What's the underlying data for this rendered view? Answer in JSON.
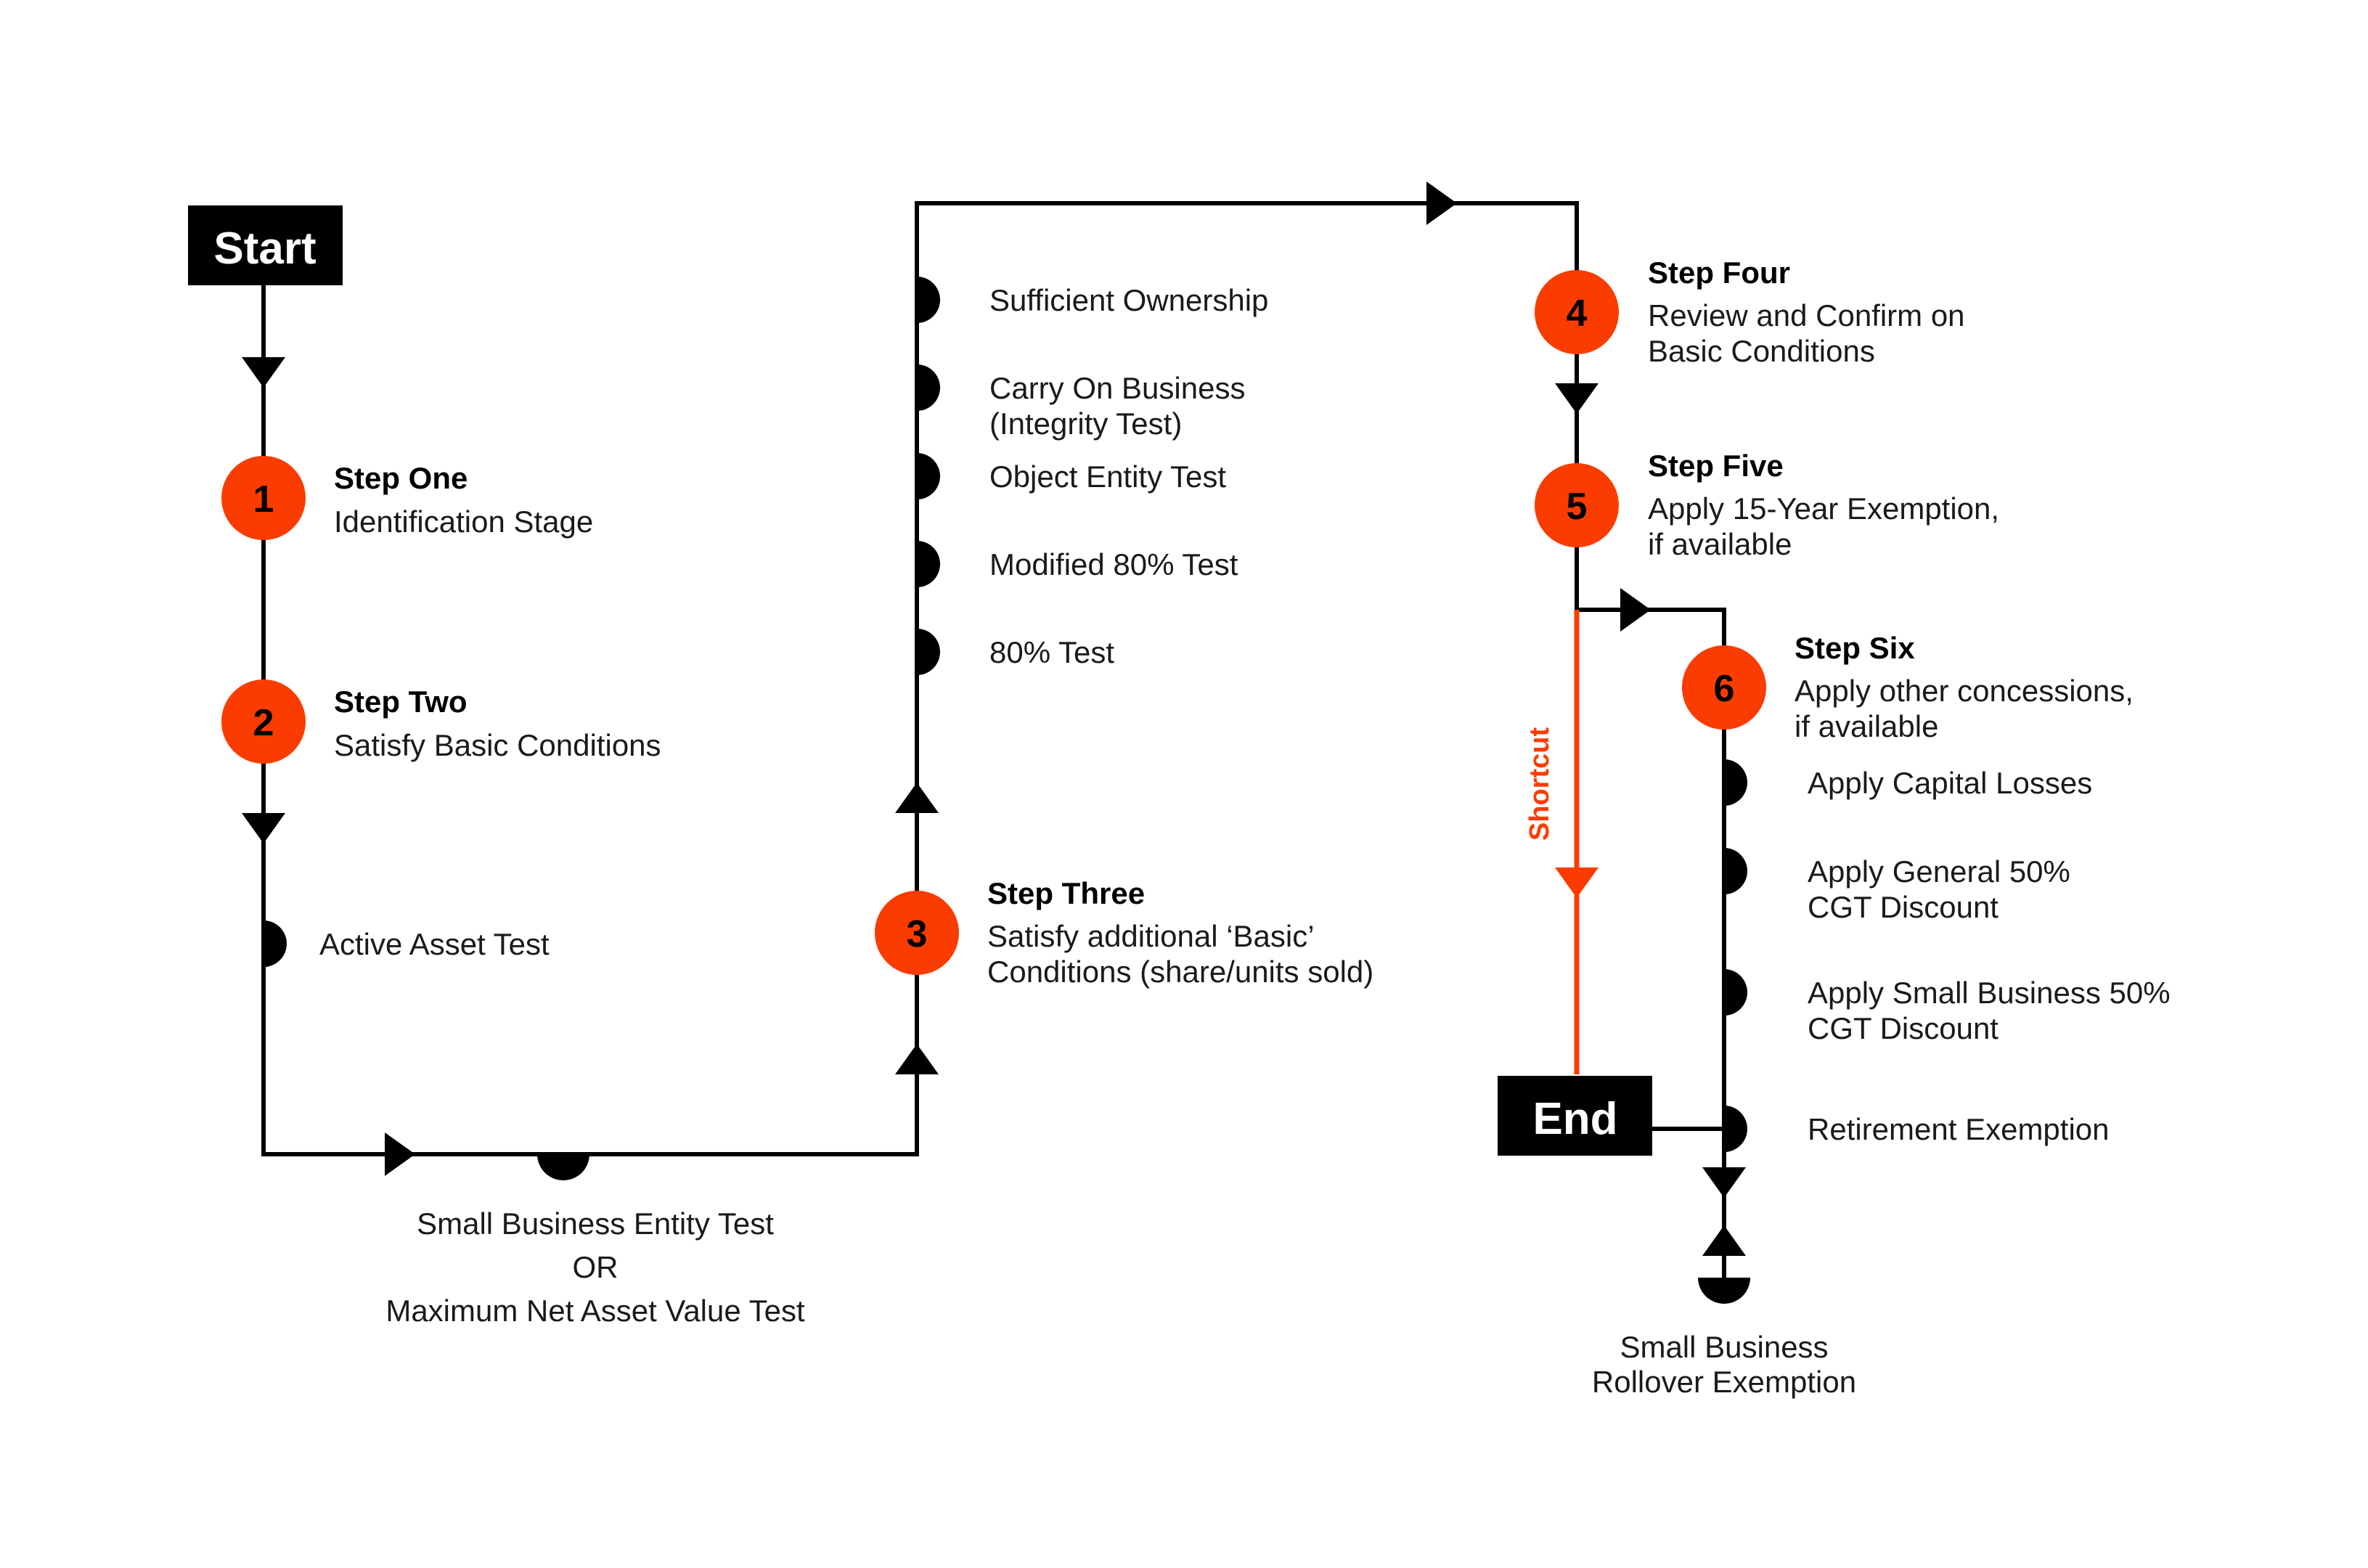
{
  "colors": {
    "accent": "#FA3C00",
    "line": "#000000",
    "terminal_fill": "#000000",
    "terminal_text": "#FFFFFF",
    "text": "#1A1A1A",
    "background": "#FFFFFF"
  },
  "terminals": {
    "start": "Start",
    "end": "End"
  },
  "steps": [
    {
      "number": "1",
      "title": "Step One",
      "desc_lines": [
        "Identification Stage"
      ]
    },
    {
      "number": "2",
      "title": "Step Two",
      "desc_lines": [
        "Satisfy Basic Conditions"
      ]
    },
    {
      "number": "3",
      "title": "Step Three",
      "desc_lines": [
        "Satisfy additional ‘Basic’",
        "Conditions (share/units sold)"
      ]
    },
    {
      "number": "4",
      "title": "Step Four",
      "desc_lines": [
        "Review and Confirm on",
        "Basic Conditions"
      ]
    },
    {
      "number": "5",
      "title": "Step Five",
      "desc_lines": [
        "Apply 15-Year Exemption,",
        "if available"
      ]
    },
    {
      "number": "6",
      "title": "Step Six",
      "desc_lines": [
        "Apply other concessions,",
        "if available"
      ]
    }
  ],
  "left_column_bullets": [
    {
      "label_lines": [
        "Active Asset Test"
      ]
    }
  ],
  "left_column_footer": {
    "lines": [
      "Small Business Entity Test",
      "OR",
      "Maximum Net Asset Value Test"
    ]
  },
  "middle_column_bullets": [
    {
      "label_lines": [
        "Sufficient Ownership"
      ]
    },
    {
      "label_lines": [
        "Carry On Business",
        "(Integrity Test)"
      ]
    },
    {
      "label_lines": [
        "Object Entity Test"
      ]
    },
    {
      "label_lines": [
        "Modified 80% Test"
      ]
    },
    {
      "label_lines": [
        "80% Test"
      ]
    }
  ],
  "right_column_bullets": [
    {
      "label_lines": [
        "Apply Capital Losses"
      ]
    },
    {
      "label_lines": [
        "Apply General 50%",
        "CGT Discount"
      ]
    },
    {
      "label_lines": [
        "Apply Small Business 50%",
        "CGT Discount"
      ]
    },
    {
      "label_lines": [
        "Retirement Exemption"
      ]
    }
  ],
  "right_column_footer": {
    "lines": [
      "Small Business",
      "Rollover Exemption"
    ]
  },
  "shortcut": {
    "label": "Shortcut"
  }
}
